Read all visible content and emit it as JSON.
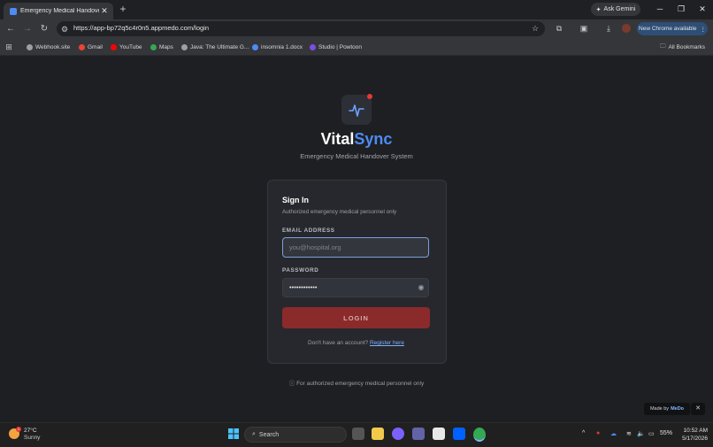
{
  "browser": {
    "tab_title": "Emergency Medical Handover",
    "tab_close": "✕",
    "new_tab": "+",
    "ask_gemini": "Ask Gemini",
    "url": "https://app-bp72q5c4r0n5.appmedo.com/login",
    "new_chrome": "New Chrome available",
    "all_bookmarks": "All Bookmarks",
    "bookmarks": [
      {
        "label": "Webhook.site",
        "color": "#9aa0a6"
      },
      {
        "label": "Gmail",
        "color": "#ea4335"
      },
      {
        "label": "YouTube",
        "color": "#ff0000"
      },
      {
        "label": "Maps",
        "color": "#34a853"
      },
      {
        "label": "Java: The Ultimate G...",
        "color": "#9aa0a6"
      },
      {
        "label": "insomnia 1.docx",
        "color": "#4d8bf5"
      },
      {
        "label": "Studio | Powtoon",
        "color": "#7b4fe0"
      }
    ]
  },
  "app": {
    "brand_main": "Vital",
    "brand_accent": "Sync",
    "subtitle": "Emergency Medical Handover System",
    "card_title": "Sign In",
    "card_subtitle": "Authorized emergency medical personnel only",
    "email_label": "EMAIL ADDRESS",
    "email_placeholder": "you@hospital.org",
    "password_label": "PASSWORD",
    "password_value": "••••••••••••",
    "login_button": "LOGIN",
    "register_prompt": "Don't have an account?",
    "register_link": "Register here",
    "footer_note": "For authorized emergency medical personnel only",
    "made_by": "Made by",
    "made_by_brand": "MeDo",
    "made_by_close": "✕",
    "colors": {
      "accent": "#4d8bf5",
      "login": "#8b2a2a",
      "notify": "#e53935"
    }
  },
  "taskbar": {
    "temperature": "27°C",
    "condition": "Sunny",
    "weather_badge": "1",
    "search": "Search",
    "battery": "55%",
    "time": "10:52 AM",
    "date": "5/17/2026"
  }
}
